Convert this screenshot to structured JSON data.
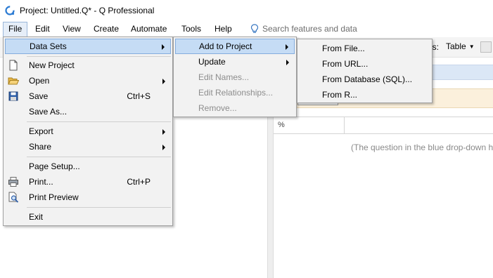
{
  "window": {
    "title": "Project: Untitled.Q* - Q Professional",
    "app_icon": "q-logo-icon",
    "accent": "#2b7bd3"
  },
  "menubar": {
    "items": [
      "File",
      "Edit",
      "View",
      "Create",
      "Automate",
      "Tools",
      "Help"
    ],
    "active": "File",
    "search_placeholder": "Search features and data",
    "search_icon": "lightbulb-icon"
  },
  "toolbar": {
    "as_label": "as:",
    "table_select": "Table"
  },
  "right_pane": {
    "grid_header": "%",
    "hint": "(The question in the blue drop-down h"
  },
  "file_menu": {
    "items": [
      {
        "label": "Data Sets",
        "submenu": true,
        "highlighted": true
      },
      {
        "label": "New Project",
        "icon": "new-document-icon"
      },
      {
        "label": "Open",
        "icon": "folder-open-icon",
        "submenu": true
      },
      {
        "label": "Save",
        "icon": "floppy-disk-icon",
        "shortcut": "Ctrl+S"
      },
      {
        "label": "Save As..."
      },
      {
        "label": "Export",
        "submenu": true
      },
      {
        "label": "Share",
        "submenu": true
      },
      {
        "label": "Page Setup..."
      },
      {
        "label": "Print...",
        "icon": "printer-icon",
        "shortcut": "Ctrl+P"
      },
      {
        "label": "Print Preview",
        "icon": "print-preview-icon"
      },
      {
        "label": "Exit"
      }
    ]
  },
  "datasets_menu": {
    "items": [
      {
        "label": "Add to Project",
        "submenu": true,
        "highlighted": true
      },
      {
        "label": "Update",
        "submenu": true
      },
      {
        "label": "Edit Names...",
        "disabled": true
      },
      {
        "label": "Edit Relationships...",
        "disabled": true
      },
      {
        "label": "Remove...",
        "disabled": true
      }
    ]
  },
  "add_menu": {
    "items": [
      {
        "label": "From File..."
      },
      {
        "label": "From URL..."
      },
      {
        "label": "From Database (SQL)..."
      },
      {
        "label": "From R..."
      }
    ]
  }
}
